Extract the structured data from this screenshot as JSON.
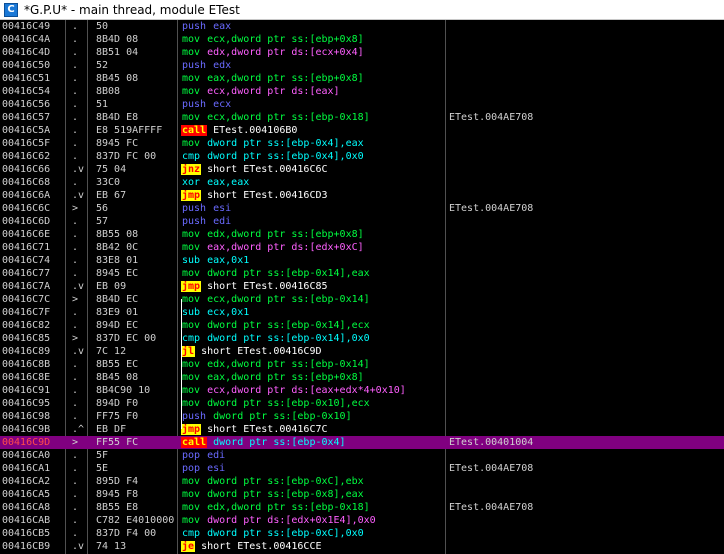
{
  "window": {
    "title": "*G.P.U* - main thread, module ETest",
    "icon_letter": "C"
  },
  "rows": [
    {
      "addr": "00416C49",
      "gut": ".",
      "bytes": "50",
      "mn": "push",
      "mc": "push",
      "ops": "eax",
      "oc": "p",
      "cmt": ""
    },
    {
      "addr": "00416C4A",
      "gut": ".",
      "bytes": "8B4D 08",
      "mn": "mov",
      "mc": "mov",
      "ops": "ecx,dword ptr ss:[ebp+0x8]",
      "oc": "g",
      "cmt": ""
    },
    {
      "addr": "00416C4D",
      "gut": ".",
      "bytes": "8B51 04",
      "mn": "mov",
      "mc": "mov",
      "ops": "edx,dword ptr ds:[ecx+0x4]",
      "oc": "m",
      "cmt": ""
    },
    {
      "addr": "00416C50",
      "gut": ".",
      "bytes": "52",
      "mn": "push",
      "mc": "push",
      "ops": "edx",
      "oc": "p",
      "cmt": ""
    },
    {
      "addr": "00416C51",
      "gut": ".",
      "bytes": "8B45 08",
      "mn": "mov",
      "mc": "mov",
      "ops": "eax,dword ptr ss:[ebp+0x8]",
      "oc": "g",
      "cmt": ""
    },
    {
      "addr": "00416C54",
      "gut": ".",
      "bytes": "8B08",
      "mn": "mov",
      "mc": "mov",
      "ops": "ecx,dword ptr ds:[eax]",
      "oc": "m",
      "cmt": ""
    },
    {
      "addr": "00416C56",
      "gut": ".",
      "bytes": "51",
      "mn": "push",
      "mc": "push",
      "ops": "ecx",
      "oc": "p",
      "cmt": ""
    },
    {
      "addr": "00416C57",
      "gut": ".",
      "bytes": "8B4D E8",
      "mn": "mov",
      "mc": "mov",
      "ops": "ecx,dword ptr ss:[ebp-0x18]",
      "oc": "g",
      "cmt": "ETest.004AE708"
    },
    {
      "addr": "00416C5A",
      "gut": ".",
      "bytes": "E8 519AFFFF",
      "mn": "call",
      "mc": "call",
      "ops": "ETest.004106B0",
      "oc": "w",
      "cmt": ""
    },
    {
      "addr": "00416C5F",
      "gut": ".",
      "bytes": "8945 FC",
      "mn": "mov",
      "mc": "mov",
      "ops": "dword ptr ss:[ebp-0x4],eax",
      "oc": "c",
      "cmt": ""
    },
    {
      "addr": "00416C62",
      "gut": ".",
      "bytes": "837D FC 00",
      "mn": "cmp",
      "mc": "cmp",
      "ops": "dword ptr ss:[ebp-0x4],0x0",
      "oc": "c",
      "cmt": ""
    },
    {
      "addr": "00416C66",
      "gut": ".v",
      "bytes": "75 04",
      "mn": "jnz",
      "mc": "jmp",
      "ops": "short ETest.00416C6C",
      "oc": "w",
      "cmt": ""
    },
    {
      "addr": "00416C68",
      "gut": ".",
      "bytes": "33C0",
      "mn": "xor",
      "mc": "xor",
      "ops": "eax,eax",
      "oc": "c",
      "cmt": ""
    },
    {
      "addr": "00416C6A",
      "gut": ".v",
      "bytes": "EB 67",
      "mn": "jmp",
      "mc": "jmp",
      "ops": "short ETest.00416CD3",
      "oc": "w",
      "cmt": ""
    },
    {
      "addr": "00416C6C",
      "gut": ">",
      "bytes": "56",
      "mn": "push",
      "mc": "push",
      "ops": "esi",
      "oc": "p",
      "cmt": "ETest.004AE708"
    },
    {
      "addr": "00416C6D",
      "gut": ".",
      "bytes": "57",
      "mn": "push",
      "mc": "push",
      "ops": "edi",
      "oc": "p",
      "cmt": ""
    },
    {
      "addr": "00416C6E",
      "gut": ".",
      "bytes": "8B55 08",
      "mn": "mov",
      "mc": "mov",
      "ops": "edx,dword ptr ss:[ebp+0x8]",
      "oc": "g",
      "cmt": ""
    },
    {
      "addr": "00416C71",
      "gut": ".",
      "bytes": "8B42 0C",
      "mn": "mov",
      "mc": "mov",
      "ops": "eax,dword ptr ds:[edx+0xC]",
      "oc": "m",
      "cmt": ""
    },
    {
      "addr": "00416C74",
      "gut": ".",
      "bytes": "83E8 01",
      "mn": "sub",
      "mc": "sub",
      "ops": "eax,0x1",
      "oc": "c",
      "cmt": ""
    },
    {
      "addr": "00416C77",
      "gut": ".",
      "bytes": "8945 EC",
      "mn": "mov",
      "mc": "mov",
      "ops": "dword ptr ss:[ebp-0x14],eax",
      "oc": "g",
      "cmt": ""
    },
    {
      "addr": "00416C7A",
      "gut": ".v",
      "bytes": "EB 09",
      "mn": "jmp",
      "mc": "jmp",
      "ops": "short ETest.00416C85",
      "oc": "w",
      "cmt": ""
    },
    {
      "addr": "00416C7C",
      "gut": ">",
      "bytes": "8B4D EC",
      "mn": "mov",
      "mc": "mov",
      "ops": "ecx,dword ptr ss:[ebp-0x14]",
      "oc": "g",
      "cmt": ""
    },
    {
      "addr": "00416C7F",
      "gut": ".",
      "bytes": "83E9 01",
      "mn": "sub",
      "mc": "sub",
      "ops": "ecx,0x1",
      "oc": "c",
      "cmt": ""
    },
    {
      "addr": "00416C82",
      "gut": ".",
      "bytes": "894D EC",
      "mn": "mov",
      "mc": "mov",
      "ops": "dword ptr ss:[ebp-0x14],ecx",
      "oc": "g",
      "cmt": ""
    },
    {
      "addr": "00416C85",
      "gut": ">",
      "bytes": "837D EC 00",
      "mn": "cmp",
      "mc": "cmp",
      "ops": "dword ptr ss:[ebp-0x14],0x0",
      "oc": "c",
      "cmt": ""
    },
    {
      "addr": "00416C89",
      "gut": ".v",
      "bytes": "7C 12",
      "mn": "jl",
      "mc": "jmp",
      "ops": "short ETest.00416C9D",
      "oc": "w",
      "cmt": ""
    },
    {
      "addr": "00416C8B",
      "gut": ".",
      "bytes": "8B55 EC",
      "mn": "mov",
      "mc": "mov",
      "ops": "edx,dword ptr ss:[ebp-0x14]",
      "oc": "g",
      "cmt": ""
    },
    {
      "addr": "00416C8E",
      "gut": ".",
      "bytes": "8B45 08",
      "mn": "mov",
      "mc": "mov",
      "ops": "eax,dword ptr ss:[ebp+0x8]",
      "oc": "g",
      "cmt": ""
    },
    {
      "addr": "00416C91",
      "gut": ".",
      "bytes": "8B4C90 10",
      "mn": "mov",
      "mc": "mov",
      "ops": "ecx,dword ptr ds:[eax+edx*4+0x10]",
      "oc": "m",
      "cmt": ""
    },
    {
      "addr": "00416C95",
      "gut": ".",
      "bytes": "894D F0",
      "mn": "mov",
      "mc": "mov",
      "ops": "dword ptr ss:[ebp-0x10],ecx",
      "oc": "g",
      "cmt": ""
    },
    {
      "addr": "00416C98",
      "gut": ".",
      "bytes": "FF75 F0",
      "mn": "push",
      "mc": "push",
      "ops": "dword ptr ss:[ebp-0x10]",
      "oc": "g",
      "cmt": ""
    },
    {
      "addr": "00416C9B",
      "gut": ".^",
      "bytes": "EB DF",
      "mn": "jmp",
      "mc": "jmp",
      "ops": "short ETest.00416C7C",
      "oc": "w",
      "cmt": ""
    },
    {
      "addr": "00416C9D",
      "gut": ">",
      "bytes": "FF55 FC",
      "mn": "call",
      "mc": "call",
      "ops": "dword ptr ss:[ebp-0x4]",
      "oc": "c",
      "cmt": "ETest.00401004"
    },
    {
      "addr": "00416CA0",
      "gut": ".",
      "bytes": "5F",
      "mn": "pop",
      "mc": "pop",
      "ops": "edi",
      "oc": "p",
      "cmt": ""
    },
    {
      "addr": "00416CA1",
      "gut": ".",
      "bytes": "5E",
      "mn": "pop",
      "mc": "pop",
      "ops": "esi",
      "oc": "p",
      "cmt": "ETest.004AE708"
    },
    {
      "addr": "00416CA2",
      "gut": ".",
      "bytes": "895D F4",
      "mn": "mov",
      "mc": "mov",
      "ops": "dword ptr ss:[ebp-0xC],ebx",
      "oc": "g",
      "cmt": ""
    },
    {
      "addr": "00416CA5",
      "gut": ".",
      "bytes": "8945 F8",
      "mn": "mov",
      "mc": "mov",
      "ops": "dword ptr ss:[ebp-0x8],eax",
      "oc": "g",
      "cmt": ""
    },
    {
      "addr": "00416CA8",
      "gut": ".",
      "bytes": "8B55 E8",
      "mn": "mov",
      "mc": "mov",
      "ops": "edx,dword ptr ss:[ebp-0x18]",
      "oc": "g",
      "cmt": "ETest.004AE708"
    },
    {
      "addr": "00416CAB",
      "gut": ".",
      "bytes": "C782 E4010000",
      "mn": "mov",
      "mc": "mov",
      "ops": "dword ptr ds:[edx+0x1E4],0x0",
      "oc": "m",
      "cmt": ""
    },
    {
      "addr": "00416CB5",
      "gut": ".",
      "bytes": "837D F4 00",
      "mn": "cmp",
      "mc": "cmp",
      "ops": "dword ptr ss:[ebp-0xC],0x0",
      "oc": "c",
      "cmt": ""
    },
    {
      "addr": "00416CB9",
      "gut": ".v",
      "bytes": "74 13",
      "mn": "je",
      "mc": "jmp",
      "ops": "short ETest.00416CCE",
      "oc": "w",
      "cmt": ""
    }
  ],
  "selected_index": 32
}
